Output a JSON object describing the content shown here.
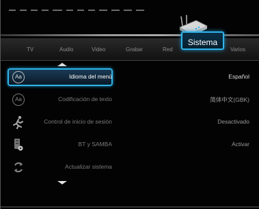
{
  "tabs": [
    {
      "label": "TV"
    },
    {
      "label": "Audio"
    },
    {
      "label": "Video"
    },
    {
      "label": "Grabar"
    },
    {
      "label": "Red"
    },
    {
      "label": "Sistema"
    },
    {
      "label": "Varios"
    }
  ],
  "menu": {
    "items": [
      {
        "label": "Idioma del menú",
        "value": "Español",
        "icon": "font-aa-icon"
      },
      {
        "label": "Codificación de texto",
        "value": "简体中文(GBK)",
        "icon": "font-aa-icon"
      },
      {
        "label": "Control de inicio de sesión",
        "value": "Desactivado",
        "icon": "running-person-icon"
      },
      {
        "label": "BT y SAMBA",
        "value": "Activar",
        "icon": "device-settings-icon"
      },
      {
        "label": "Actualizar sistema",
        "value": "",
        "icon": "refresh-icon"
      }
    ]
  },
  "colors": {
    "accent": "#2fb4e8",
    "background": "#030303"
  },
  "icon_glyph": "Aa"
}
